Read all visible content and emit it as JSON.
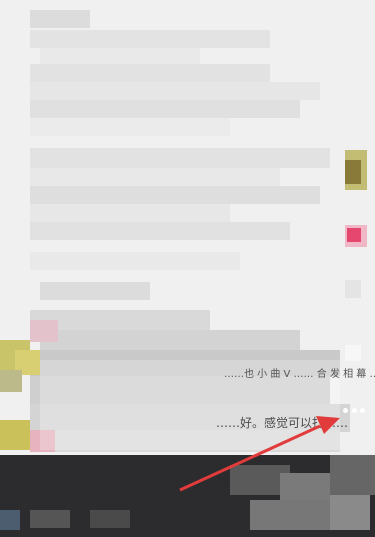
{
  "screen": {
    "caption_line_1": "……也 小 曲 V …… 合 发 相 幕 ……",
    "caption_line_2": "……好。感觉可以打……",
    "more_icon": "more-dots-icon",
    "annotation_arrow_color": "#e23b3b"
  }
}
